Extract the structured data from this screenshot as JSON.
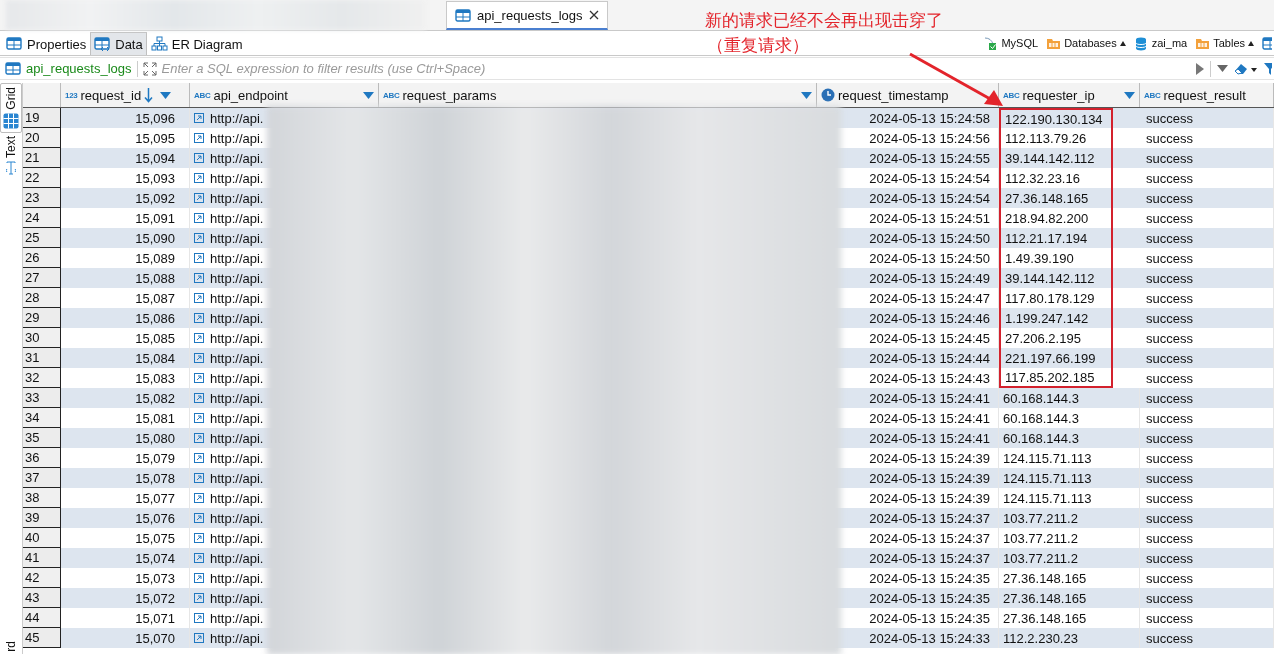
{
  "editor_tabs": [
    {
      "label": "api_requests_logs",
      "selected": true
    }
  ],
  "view_tabs": [
    {
      "label": "Properties",
      "kind": "properties",
      "selected": false
    },
    {
      "label": "Data",
      "kind": "data",
      "selected": true
    },
    {
      "label": "ER Diagram",
      "kind": "diagram",
      "selected": false
    }
  ],
  "breadcrumbs": [
    {
      "label": "MySQL",
      "kind": "connection"
    },
    {
      "label": "Databases",
      "kind": "folder"
    },
    {
      "label": "zai_ma",
      "kind": "database"
    },
    {
      "label": "Tables",
      "kind": "folder"
    }
  ],
  "filter": {
    "table_name": "api_requests_logs",
    "placeholder": "Enter a SQL expression to filter results (use Ctrl+Space)"
  },
  "side_tabs": [
    {
      "label": "Grid",
      "kind": "grid",
      "selected": true
    },
    {
      "label": "Text",
      "kind": "text",
      "selected": false
    },
    {
      "label": "rd",
      "kind": "record",
      "selected": false
    }
  ],
  "columns": [
    {
      "name": "request_id",
      "kind": "number",
      "type_label": "123",
      "sorted": true,
      "filter_button": true
    },
    {
      "name": "api_endpoint",
      "kind": "text",
      "type_label": "ABC",
      "sorted": false,
      "filter_button": true
    },
    {
      "name": "request_params",
      "kind": "text",
      "type_label": "ABC",
      "sorted": false,
      "filter_button": true
    },
    {
      "name": "request_timestamp",
      "kind": "datetime",
      "sorted": false,
      "filter_button": false
    },
    {
      "name": "requester_ip",
      "kind": "text",
      "type_label": "ABC",
      "sorted": false,
      "filter_button": true
    },
    {
      "name": "request_result",
      "kind": "text",
      "type_label": "ABC",
      "sorted": false,
      "filter_button": false
    }
  ],
  "rows": [
    {
      "row": "19",
      "request_id": "15,096",
      "api_endpoint": "http://api.",
      "request_timestamp": "2024-05-13 15:24:58",
      "requester_ip": "122.190.130.134",
      "request_result": "success",
      "highlighted": true
    },
    {
      "row": "20",
      "request_id": "15,095",
      "api_endpoint": "http://api.",
      "request_timestamp": "2024-05-13 15:24:56",
      "requester_ip": "112.113.79.26",
      "request_result": "success",
      "highlighted": true
    },
    {
      "row": "21",
      "request_id": "15,094",
      "api_endpoint": "http://api.",
      "request_timestamp": "2024-05-13 15:24:55",
      "requester_ip": "39.144.142.112",
      "request_result": "success",
      "highlighted": true
    },
    {
      "row": "22",
      "request_id": "15,093",
      "api_endpoint": "http://api.",
      "request_timestamp": "2024-05-13 15:24:54",
      "requester_ip": "112.32.23.16",
      "request_result": "success",
      "highlighted": true
    },
    {
      "row": "23",
      "request_id": "15,092",
      "api_endpoint": "http://api.",
      "request_timestamp": "2024-05-13 15:24:54",
      "requester_ip": "27.36.148.165",
      "request_result": "success",
      "highlighted": true
    },
    {
      "row": "24",
      "request_id": "15,091",
      "api_endpoint": "http://api.",
      "request_timestamp": "2024-05-13 15:24:51",
      "requester_ip": "218.94.82.200",
      "request_result": "success",
      "highlighted": true
    },
    {
      "row": "25",
      "request_id": "15,090",
      "api_endpoint": "http://api.",
      "request_timestamp": "2024-05-13 15:24:50",
      "requester_ip": "112.21.17.194",
      "request_result": "success",
      "highlighted": true
    },
    {
      "row": "26",
      "request_id": "15,089",
      "api_endpoint": "http://api.",
      "request_timestamp": "2024-05-13 15:24:50",
      "requester_ip": "1.49.39.190",
      "request_result": "success",
      "highlighted": true
    },
    {
      "row": "27",
      "request_id": "15,088",
      "api_endpoint": "http://api.",
      "request_timestamp": "2024-05-13 15:24:49",
      "requester_ip": "39.144.142.112",
      "request_result": "success",
      "highlighted": true
    },
    {
      "row": "28",
      "request_id": "15,087",
      "api_endpoint": "http://api.",
      "request_timestamp": "2024-05-13 15:24:47",
      "requester_ip": "117.80.178.129",
      "request_result": "success",
      "highlighted": true
    },
    {
      "row": "29",
      "request_id": "15,086",
      "api_endpoint": "http://api.",
      "request_timestamp": "2024-05-13 15:24:46",
      "requester_ip": "1.199.247.142",
      "request_result": "success",
      "highlighted": true
    },
    {
      "row": "30",
      "request_id": "15,085",
      "api_endpoint": "http://api.",
      "request_timestamp": "2024-05-13 15:24:45",
      "requester_ip": "27.206.2.195",
      "request_result": "success",
      "highlighted": true
    },
    {
      "row": "31",
      "request_id": "15,084",
      "api_endpoint": "http://api.",
      "request_timestamp": "2024-05-13 15:24:44",
      "requester_ip": "221.197.66.199",
      "request_result": "success",
      "highlighted": true
    },
    {
      "row": "32",
      "request_id": "15,083",
      "api_endpoint": "http://api.",
      "request_timestamp": "2024-05-13 15:24:43",
      "requester_ip": "117.85.202.185",
      "request_result": "success",
      "highlighted": true
    },
    {
      "row": "33",
      "request_id": "15,082",
      "api_endpoint": "http://api.",
      "request_timestamp": "2024-05-13 15:24:41",
      "requester_ip": "60.168.144.3",
      "request_result": "success",
      "highlighted": false
    },
    {
      "row": "34",
      "request_id": "15,081",
      "api_endpoint": "http://api.",
      "request_timestamp": "2024-05-13 15:24:41",
      "requester_ip": "60.168.144.3",
      "request_result": "success",
      "highlighted": false
    },
    {
      "row": "35",
      "request_id": "15,080",
      "api_endpoint": "http://api.",
      "request_timestamp": "2024-05-13 15:24:41",
      "requester_ip": "60.168.144.3",
      "request_result": "success",
      "highlighted": false
    },
    {
      "row": "36",
      "request_id": "15,079",
      "api_endpoint": "http://api.",
      "request_timestamp": "2024-05-13 15:24:39",
      "requester_ip": "124.115.71.113",
      "request_result": "success",
      "highlighted": false
    },
    {
      "row": "37",
      "request_id": "15,078",
      "api_endpoint": "http://api.",
      "request_timestamp": "2024-05-13 15:24:39",
      "requester_ip": "124.115.71.113",
      "request_result": "success",
      "highlighted": false
    },
    {
      "row": "38",
      "request_id": "15,077",
      "api_endpoint": "http://api.",
      "request_timestamp": "2024-05-13 15:24:39",
      "requester_ip": "124.115.71.113",
      "request_result": "success",
      "highlighted": false
    },
    {
      "row": "39",
      "request_id": "15,076",
      "api_endpoint": "http://api.",
      "request_timestamp": "2024-05-13 15:24:37",
      "requester_ip": "103.77.211.2",
      "request_result": "success",
      "highlighted": false
    },
    {
      "row": "40",
      "request_id": "15,075",
      "api_endpoint": "http://api.",
      "request_timestamp": "2024-05-13 15:24:37",
      "requester_ip": "103.77.211.2",
      "request_result": "success",
      "highlighted": false
    },
    {
      "row": "41",
      "request_id": "15,074",
      "api_endpoint": "http://api.",
      "request_timestamp": "2024-05-13 15:24:37",
      "requester_ip": "103.77.211.2",
      "request_result": "success",
      "highlighted": false
    },
    {
      "row": "42",
      "request_id": "15,073",
      "api_endpoint": "http://api.",
      "request_timestamp": "2024-05-13 15:24:35",
      "requester_ip": "27.36.148.165",
      "request_result": "success",
      "highlighted": false
    },
    {
      "row": "43",
      "request_id": "15,072",
      "api_endpoint": "http://api.",
      "request_timestamp": "2024-05-13 15:24:35",
      "requester_ip": "27.36.148.165",
      "request_result": "success",
      "highlighted": false
    },
    {
      "row": "44",
      "request_id": "15,071",
      "api_endpoint": "http://api.",
      "request_timestamp": "2024-05-13 15:24:35",
      "requester_ip": "27.36.148.165",
      "request_result": "success",
      "highlighted": false
    },
    {
      "row": "45",
      "request_id": "15,070",
      "api_endpoint": "http://api.",
      "request_timestamp": "2024-05-13 15:24:33",
      "requester_ip": "112.2.230.23",
      "request_result": "success",
      "highlighted": false
    }
  ],
  "annotation": {
    "lines": [
      "新的请求已经不会再出现击穿了",
      "（重复请求）"
    ]
  }
}
